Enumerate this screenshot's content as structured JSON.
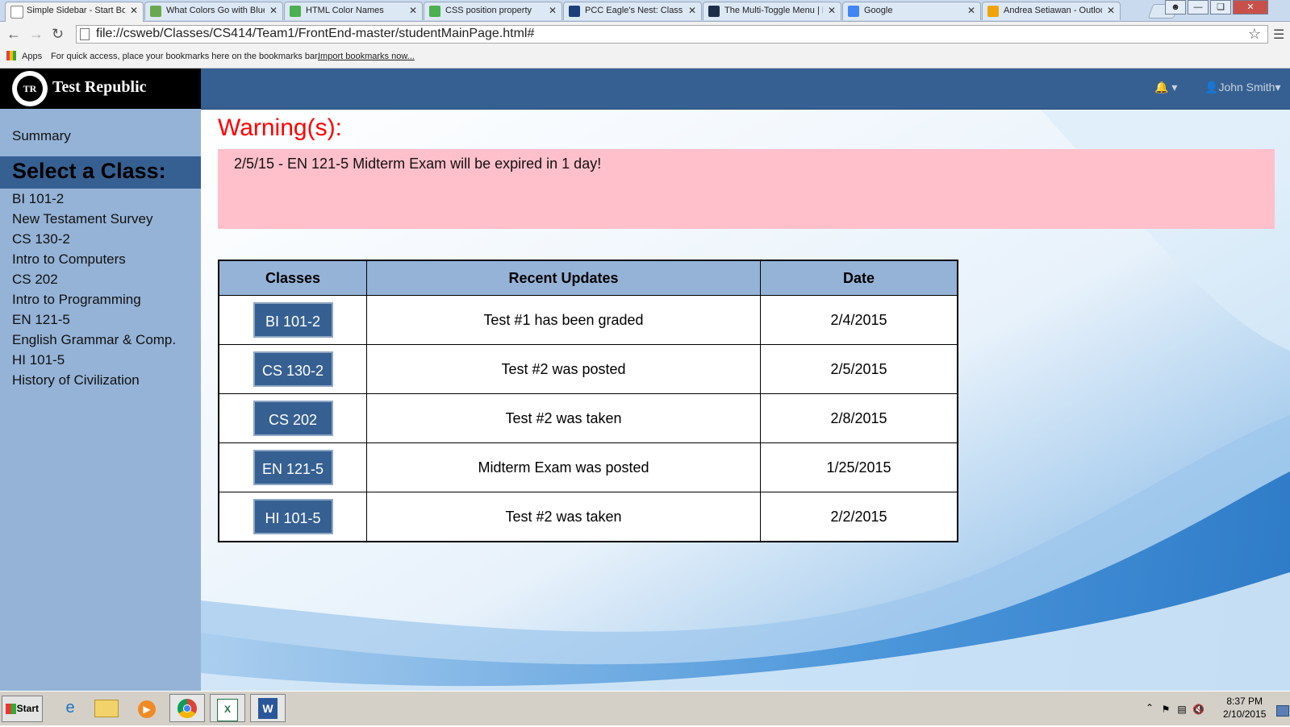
{
  "browser": {
    "tabs": [
      {
        "title": "Simple Sidebar - Start Boo",
        "active": true,
        "favicon": "page-icon",
        "color": "#ffffff"
      },
      {
        "title": "What Colors Go with Blue",
        "active": false,
        "favicon": "palette-icon",
        "color": "#6aa84f"
      },
      {
        "title": "HTML Color Names",
        "active": false,
        "favicon": "w3-icon",
        "color": "#4caf50"
      },
      {
        "title": "CSS position property",
        "active": false,
        "favicon": "w3-icon",
        "color": "#4caf50"
      },
      {
        "title": "PCC Eagle's Nest: Class G",
        "active": false,
        "favicon": "eagle-icon",
        "color": "#1c3f7a"
      },
      {
        "title": "The Multi-Toggle Menu | F",
        "active": false,
        "favicon": "site-icon",
        "color": "#1c2e4a"
      },
      {
        "title": "Google",
        "active": false,
        "favicon": "google-icon",
        "color": "#4285f4"
      },
      {
        "title": "Andrea Setiawan - Outloo",
        "active": false,
        "favicon": "outlook-icon",
        "color": "#f0a30a"
      }
    ],
    "url": "file://csweb/Classes/CS414/Team1/FrontEnd-master/studentMainPage.html#",
    "bookmarks": {
      "apps_label": "Apps",
      "hint": "For quick access, place your bookmarks here on the bookmarks bar.",
      "import_link": "Import bookmarks now..."
    }
  },
  "header": {
    "brand_title": "Test Republic",
    "logo_text": "TR",
    "user_name": "John Smith",
    "brand_color": "#366092"
  },
  "sidebar": {
    "summary_label": "Summary",
    "heading": "Select a Class:",
    "items": [
      "BI 101-2",
      "New Testament Survey",
      "CS 130-2",
      "Intro to Computers",
      "CS 202",
      "Intro to Programming",
      "EN 121-5",
      "English Grammar & Comp.",
      "HI 101-5",
      "History of Civilization"
    ]
  },
  "warnings": {
    "title": "Warning(s):",
    "message": "2/5/15 - EN 121-5 Midterm Exam will be expired in 1 day!",
    "title_color": "#ff0000",
    "box_color": "#ffc0cb"
  },
  "updates_table": {
    "headers": [
      "Classes",
      "Recent Updates",
      "Date"
    ],
    "rows": [
      {
        "class": "BI 101-2",
        "update": "Test #1 has been graded",
        "date": "2/4/2015"
      },
      {
        "class": "CS 130-2",
        "update": "Test #2 was posted",
        "date": "2/5/2015"
      },
      {
        "class": "CS 202",
        "update": "Test #2 was taken",
        "date": "2/8/2015"
      },
      {
        "class": "EN 121-5",
        "update": "Midterm Exam was posted",
        "date": "1/25/2015"
      },
      {
        "class": "HI 101-5",
        "update": "Test #2 was taken",
        "date": "2/2/2015"
      }
    ]
  },
  "taskbar": {
    "start_label": "Start",
    "apps": [
      "ie-icon",
      "explorer-folder-icon",
      "media-player-icon",
      "chrome-icon",
      "excel-icon",
      "word-icon"
    ],
    "time": "8:37 PM",
    "date": "2/10/2015"
  }
}
